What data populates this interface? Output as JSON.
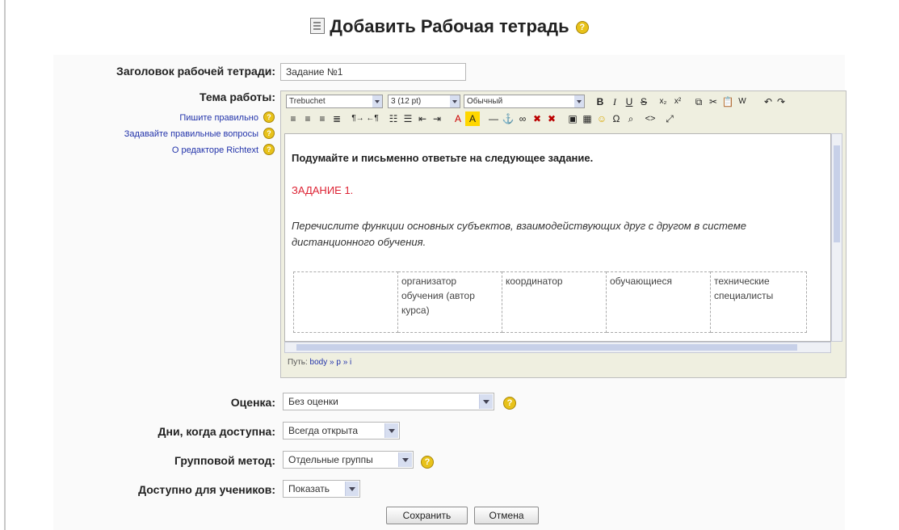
{
  "page": {
    "title": "Добавить Рабочая тетрадь"
  },
  "fields": {
    "title_label": "Заголовок рабочей тетради:",
    "title_value": "Задание №1",
    "topic_label": "Тема работы:",
    "grade_label": "Оценка:",
    "grade_value": "Без оценки",
    "days_label": "Дни, когда доступна:",
    "days_value": "Всегда открыта",
    "group_label": "Групповой метод:",
    "group_value": "Отдельные группы",
    "visible_label": "Доступно для учеников:",
    "visible_value": "Показать"
  },
  "side_links": [
    "Пишите правильно",
    "Задавайте правильные вопросы",
    "О редакторе Richtext"
  ],
  "editor": {
    "font_value": "Trebuchet",
    "size_value": "3 (12 pt)",
    "style_value": "Обычный",
    "heading_text": "Подумайте и письменно ответьте на следующее задание.",
    "task_text": "ЗАДАНИЕ 1.",
    "instruction_text": "Перечислите функции основных субъектов, взаимодействующих друг с другом в системе дистанционного обучения.",
    "table_headers": [
      "",
      "организатор обучения (автор курса)",
      "координатор",
      "обучающиеся",
      "технические специалисты"
    ],
    "path_label": "Путь:",
    "path_value": "body » p » i"
  },
  "buttons": {
    "save": "Сохранить",
    "cancel": "Отмена"
  },
  "colors": {
    "task_red": "#dd2233",
    "link_blue": "#2233aa",
    "help_yellow": "#e8c21a"
  }
}
